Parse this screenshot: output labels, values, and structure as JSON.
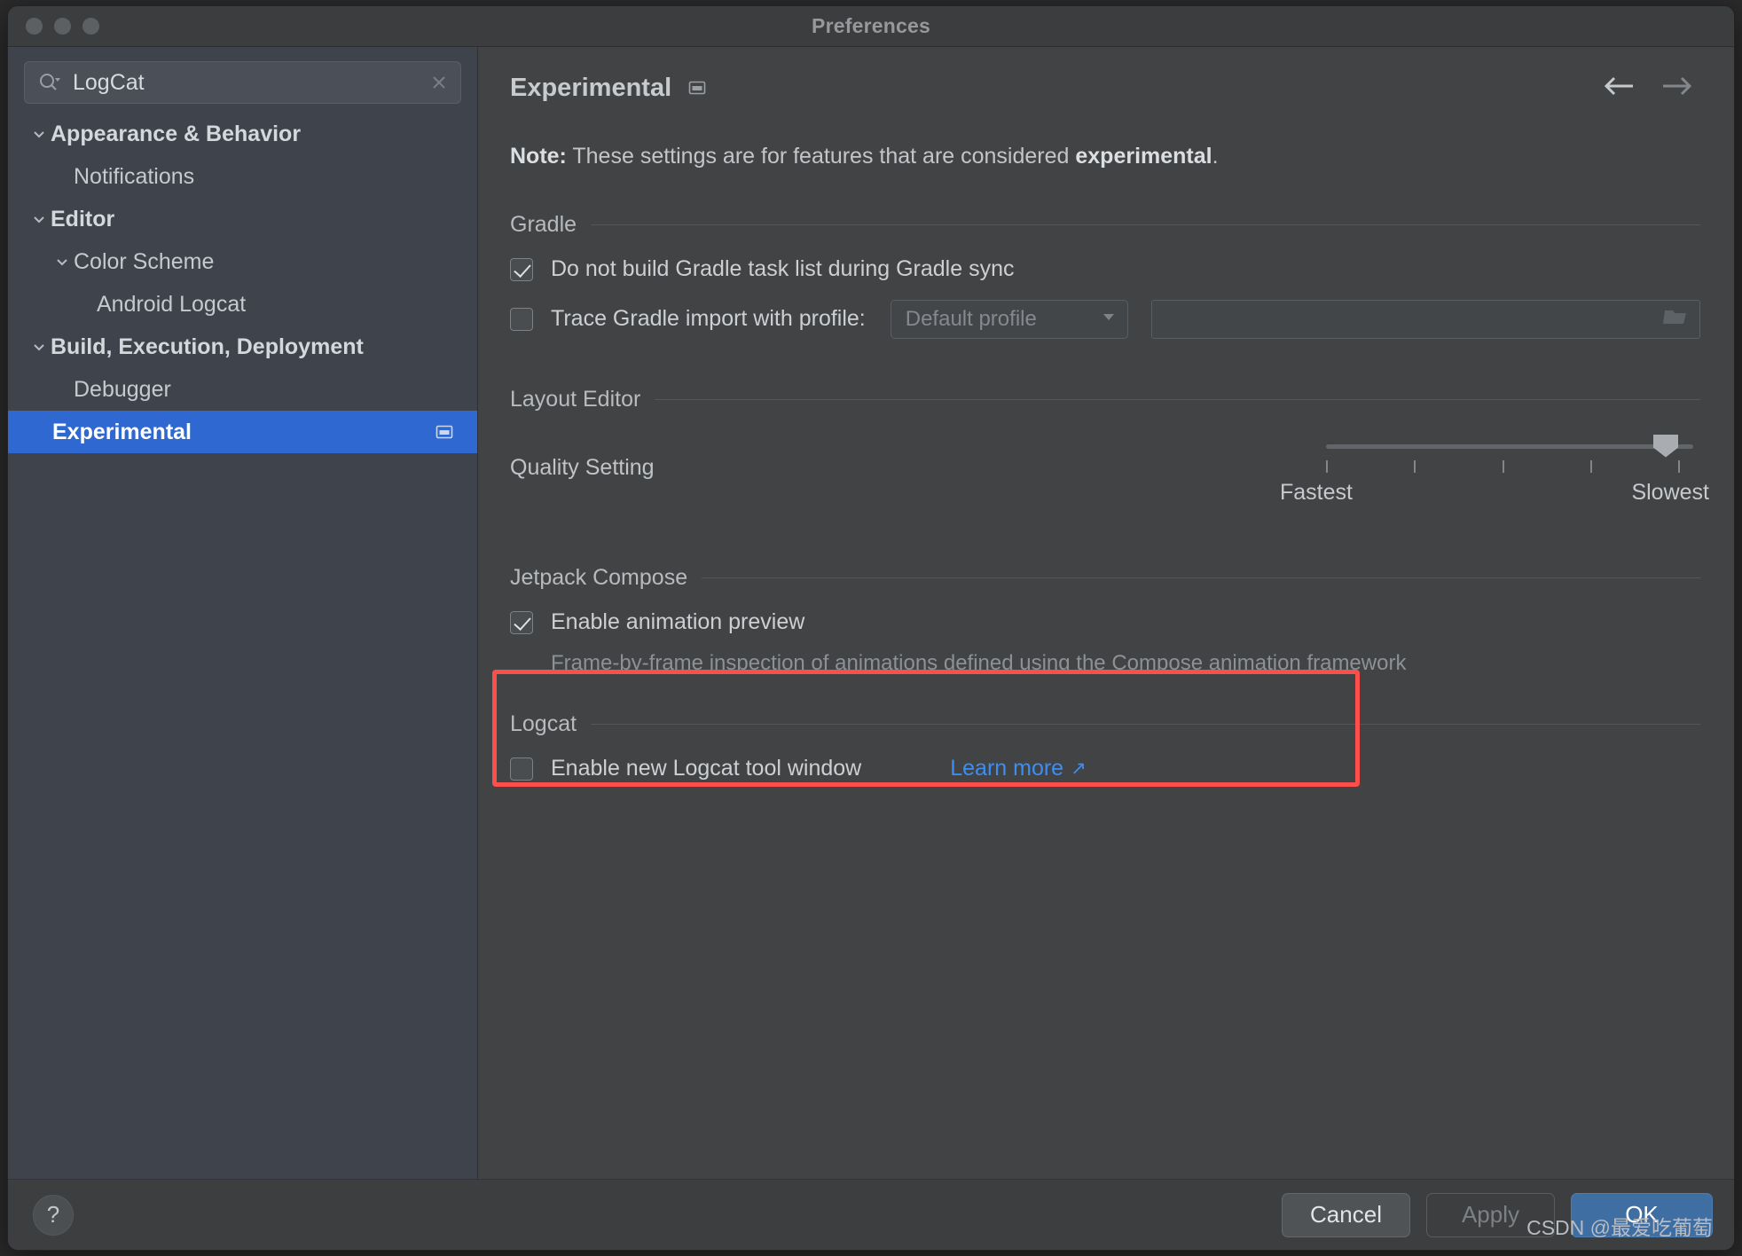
{
  "window": {
    "title": "Preferences",
    "traffic_lights": [
      "close",
      "minimize",
      "zoom"
    ]
  },
  "sidebar": {
    "search": {
      "value": "LogCat",
      "placeholder": ""
    },
    "items": [
      {
        "label": "Appearance & Behavior",
        "indent": 0,
        "expandable": true,
        "bold": true,
        "selected": false,
        "badge": false
      },
      {
        "label": "Notifications",
        "indent": 1,
        "expandable": false,
        "bold": false,
        "selected": false,
        "badge": false
      },
      {
        "label": "Editor",
        "indent": 0,
        "expandable": true,
        "bold": true,
        "selected": false,
        "badge": false
      },
      {
        "label": "Color Scheme",
        "indent": 1,
        "expandable": true,
        "bold": false,
        "selected": false,
        "badge": false
      },
      {
        "label": "Android Logcat",
        "indent": 2,
        "expandable": false,
        "bold": false,
        "selected": false,
        "badge": false
      },
      {
        "label": "Build, Execution, Deployment",
        "indent": 0,
        "expandable": true,
        "bold": true,
        "selected": false,
        "badge": false
      },
      {
        "label": "Debugger",
        "indent": 1,
        "expandable": false,
        "bold": false,
        "selected": false,
        "badge": false
      },
      {
        "label": "Experimental",
        "indent": 1,
        "expandable": false,
        "bold": true,
        "selected": true,
        "badge": true
      }
    ]
  },
  "main": {
    "title": "Experimental",
    "note_prefix": "Note:",
    "note_body": " These settings are for features that are considered ",
    "note_emphasis": "experimental",
    "note_suffix": ".",
    "gradle": {
      "group_label": "Gradle",
      "checkbox_no_task_list": {
        "label": "Do not build Gradle task list during Gradle sync",
        "checked": true
      },
      "checkbox_trace": {
        "label": "Trace Gradle import with profile:",
        "checked": false
      },
      "profile_select": {
        "value": "Default profile"
      },
      "profile_path": {
        "value": "",
        "placeholder": ""
      }
    },
    "layout_editor": {
      "group_label": "Layout Editor",
      "quality_label": "Quality Setting",
      "slider": {
        "min_label": "Fastest",
        "max_label": "Slowest",
        "ticks": 5,
        "value": 5,
        "max": 5
      }
    },
    "jetpack_compose": {
      "group_label": "Jetpack Compose",
      "checkbox_animation_preview": {
        "label": "Enable animation preview",
        "checked": true
      },
      "description": "Frame-by-frame inspection of animations defined using the Compose animation framework"
    },
    "logcat": {
      "group_label": "Logcat",
      "checkbox_new_tool_window": {
        "label": "Enable new Logcat tool window",
        "checked": false
      },
      "learn_more_label": "Learn more",
      "highlight_color": "#fc4f4b"
    }
  },
  "footer": {
    "help_label": "?",
    "cancel_label": "Cancel",
    "apply_label": "Apply",
    "ok_label": "OK",
    "apply_enabled": false
  },
  "watermark": "CSDN @最爱吃葡萄",
  "colors": {
    "selection_blue": "#2f68d0",
    "link_blue": "#3d8ef0",
    "ok_blue": "#3f6ea3",
    "highlight_red": "#fc4f4b",
    "sidebar_bg": "#3f434c",
    "panel_bg": "#414345"
  }
}
